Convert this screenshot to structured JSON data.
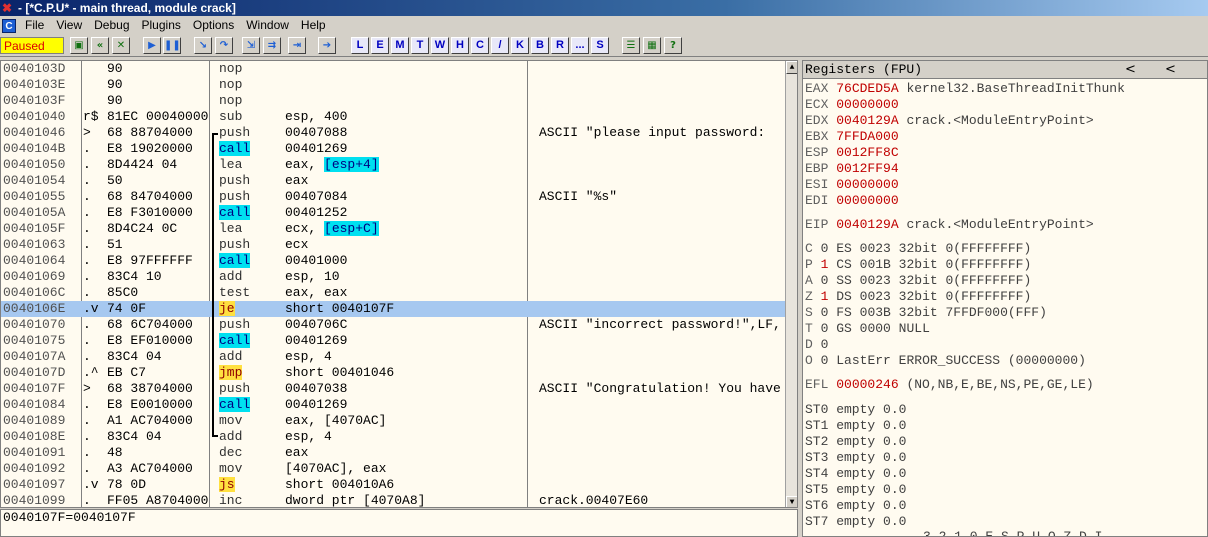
{
  "window": {
    "title": "- [*C.P.U* - main thread, module crack]"
  },
  "menu": [
    "File",
    "View",
    "Debug",
    "Plugins",
    "Options",
    "Window",
    "Help"
  ],
  "app_icon_letter": "C",
  "status": "Paused",
  "toolbar": {
    "icons": [
      "open-icon",
      "rewind-icon",
      "close-icon",
      "run-icon",
      "pause-icon",
      "step-into-icon",
      "step-over-icon",
      "trace-into-icon",
      "trace-over-icon",
      "execute-till-return-icon",
      "goto-icon"
    ],
    "letters": [
      "L",
      "E",
      "M",
      "T",
      "W",
      "H",
      "C",
      "/",
      "K",
      "B",
      "R",
      "...",
      "S"
    ],
    "right_icons": [
      "list-icon",
      "grid-icon",
      "help-icon"
    ]
  },
  "disasm": [
    {
      "addr": "0040103D",
      "arrow": "",
      "hex": "90",
      "mn": "nop",
      "ops": "",
      "cmt": "",
      "hl": ""
    },
    {
      "addr": "0040103E",
      "arrow": "",
      "hex": "90",
      "mn": "nop",
      "ops": "",
      "cmt": "",
      "hl": ""
    },
    {
      "addr": "0040103F",
      "arrow": "",
      "hex": "90",
      "mn": "nop",
      "ops": "",
      "cmt": "",
      "hl": ""
    },
    {
      "addr": "00401040",
      "arrow": "r$",
      "hex": "81EC 00040000",
      "mn": "sub",
      "ops": "esp, 400",
      "cmt": "",
      "hl": ""
    },
    {
      "addr": "00401046",
      "arrow": ">",
      "hex": "68 88704000",
      "mn": "push",
      "ops": "00407088",
      "cmt": "ASCII \"please input password:",
      "hl": ""
    },
    {
      "addr": "0040104B",
      "arrow": ".",
      "hex": "E8 19020000",
      "mn": "call",
      "ops": "00401269",
      "cmt": "",
      "hl": "cyan"
    },
    {
      "addr": "00401050",
      "arrow": ".",
      "hex": "8D4424 04",
      "mn": "lea",
      "ops": "eax, [esp+4]",
      "cmt": "",
      "hl": "",
      "ophl": "[esp+4]"
    },
    {
      "addr": "00401054",
      "arrow": ".",
      "hex": "50",
      "mn": "push",
      "ops": "eax",
      "cmt": "",
      "hl": ""
    },
    {
      "addr": "00401055",
      "arrow": ".",
      "hex": "68 84704000",
      "mn": "push",
      "ops": "00407084",
      "cmt": "ASCII \"%s\"",
      "hl": ""
    },
    {
      "addr": "0040105A",
      "arrow": ".",
      "hex": "E8 F3010000",
      "mn": "call",
      "ops": "00401252",
      "cmt": "",
      "hl": "cyan"
    },
    {
      "addr": "0040105F",
      "arrow": ".",
      "hex": "8D4C24 0C",
      "mn": "lea",
      "ops": "ecx, [esp+C]",
      "cmt": "",
      "hl": "",
      "ophl": "[esp+C]"
    },
    {
      "addr": "00401063",
      "arrow": ".",
      "hex": "51",
      "mn": "push",
      "ops": "ecx",
      "cmt": "",
      "hl": ""
    },
    {
      "addr": "00401064",
      "arrow": ".",
      "hex": "E8 97FFFFFF",
      "mn": "call",
      "ops": "00401000",
      "cmt": "",
      "hl": "cyan"
    },
    {
      "addr": "00401069",
      "arrow": ".",
      "hex": "83C4 10",
      "mn": "add",
      "ops": "esp, 10",
      "cmt": "",
      "hl": ""
    },
    {
      "addr": "0040106C",
      "arrow": ".",
      "hex": "85C0",
      "mn": "test",
      "ops": "eax, eax",
      "cmt": "",
      "hl": ""
    },
    {
      "addr": "0040106E",
      "arrow": ".v",
      "hex": "74 0F",
      "mn": "je",
      "ops": "short 0040107F",
      "cmt": "",
      "hl": "yel",
      "sel": true
    },
    {
      "addr": "00401070",
      "arrow": ".",
      "hex": "68 6C704000",
      "mn": "push",
      "ops": "0040706C",
      "cmt": "ASCII \"incorrect password!\",LF,",
      "hl": ""
    },
    {
      "addr": "00401075",
      "arrow": ".",
      "hex": "E8 EF010000",
      "mn": "call",
      "ops": "00401269",
      "cmt": "",
      "hl": "cyan"
    },
    {
      "addr": "0040107A",
      "arrow": ".",
      "hex": "83C4 04",
      "mn": "add",
      "ops": "esp, 4",
      "cmt": "",
      "hl": ""
    },
    {
      "addr": "0040107D",
      "arrow": ".^",
      "hex": "EB C7",
      "mn": "jmp",
      "ops": "short 00401046",
      "cmt": "",
      "hl": "yel"
    },
    {
      "addr": "0040107F",
      "arrow": ">",
      "hex": "68 38704000",
      "mn": "push",
      "ops": "00407038",
      "cmt": "ASCII \"Congratulation! You have",
      "hl": ""
    },
    {
      "addr": "00401084",
      "arrow": ".",
      "hex": "E8 E0010000",
      "mn": "call",
      "ops": "00401269",
      "cmt": "",
      "hl": "cyan"
    },
    {
      "addr": "00401089",
      "arrow": ".",
      "hex": "A1 AC704000",
      "mn": "mov",
      "ops": "eax, [4070AC]",
      "cmt": "",
      "hl": ""
    },
    {
      "addr": "0040108E",
      "arrow": ".",
      "hex": "83C4 04",
      "mn": "add",
      "ops": "esp, 4",
      "cmt": "",
      "hl": ""
    },
    {
      "addr": "00401091",
      "arrow": ".",
      "hex": "48",
      "mn": "dec",
      "ops": "eax",
      "cmt": "",
      "hl": ""
    },
    {
      "addr": "00401092",
      "arrow": ".",
      "hex": "A3 AC704000",
      "mn": "mov",
      "ops": "[4070AC], eax",
      "cmt": "",
      "hl": ""
    },
    {
      "addr": "00401097",
      "arrow": ".v",
      "hex": "78 0D",
      "mn": "js",
      "ops": "short 004010A6",
      "cmt": "",
      "hl": "yel"
    },
    {
      "addr": "00401099",
      "arrow": ".",
      "hex": "FF05 A8704000",
      "mn": "inc",
      "ops": "dword ptr [4070A8]",
      "cmt": "crack.00407E60",
      "hl": ""
    }
  ],
  "infobar": "0040107F=0040107F",
  "registers": {
    "header": "Registers (FPU)",
    "nav_left": "<",
    "nav_left2": "<",
    "gpr": [
      {
        "name": "EAX",
        "value": "76CDED5A",
        "note": "kernel32.BaseThreadInitThunk"
      },
      {
        "name": "ECX",
        "value": "00000000",
        "note": ""
      },
      {
        "name": "EDX",
        "value": "0040129A",
        "note": "crack.<ModuleEntryPoint>"
      },
      {
        "name": "EBX",
        "value": "7FFDA000",
        "note": ""
      },
      {
        "name": "ESP",
        "value": "0012FF8C",
        "note": ""
      },
      {
        "name": "EBP",
        "value": "0012FF94",
        "note": ""
      },
      {
        "name": "ESI",
        "value": "00000000",
        "note": ""
      },
      {
        "name": "EDI",
        "value": "00000000",
        "note": ""
      }
    ],
    "eip": {
      "name": "EIP",
      "value": "0040129A",
      "note": "crack.<ModuleEntryPoint>"
    },
    "flags": [
      {
        "f": "C",
        "v": "0",
        "seg": "ES 0023 32bit 0(FFFFFFFF)"
      },
      {
        "f": "P",
        "v": "1",
        "seg": "CS 001B 32bit 0(FFFFFFFF)"
      },
      {
        "f": "A",
        "v": "0",
        "seg": "SS 0023 32bit 0(FFFFFFFF)"
      },
      {
        "f": "Z",
        "v": "1",
        "seg": "DS 0023 32bit 0(FFFFFFFF)"
      },
      {
        "f": "S",
        "v": "0",
        "seg": "FS 003B 32bit 7FFDF000(FFF)"
      },
      {
        "f": "T",
        "v": "0",
        "seg": "GS 0000 NULL"
      },
      {
        "f": "D",
        "v": "0",
        "seg": ""
      },
      {
        "f": "O",
        "v": "0",
        "seg": "LastErr ERROR_SUCCESS (00000000)"
      }
    ],
    "efl": {
      "name": "EFL",
      "value": "00000246",
      "note": "(NO,NB,E,BE,NS,PE,GE,LE)"
    },
    "fpu": [
      "ST0 empty 0.0",
      "ST1 empty 0.0",
      "ST2 empty 0.0",
      "ST3 empty 0.0",
      "ST4 empty 0.0",
      "ST5 empty 0.0",
      "ST6 empty 0.0",
      "ST7 empty 0.0"
    ],
    "bottom_partial": "3 2 1 0      E S P U O Z D I"
  }
}
